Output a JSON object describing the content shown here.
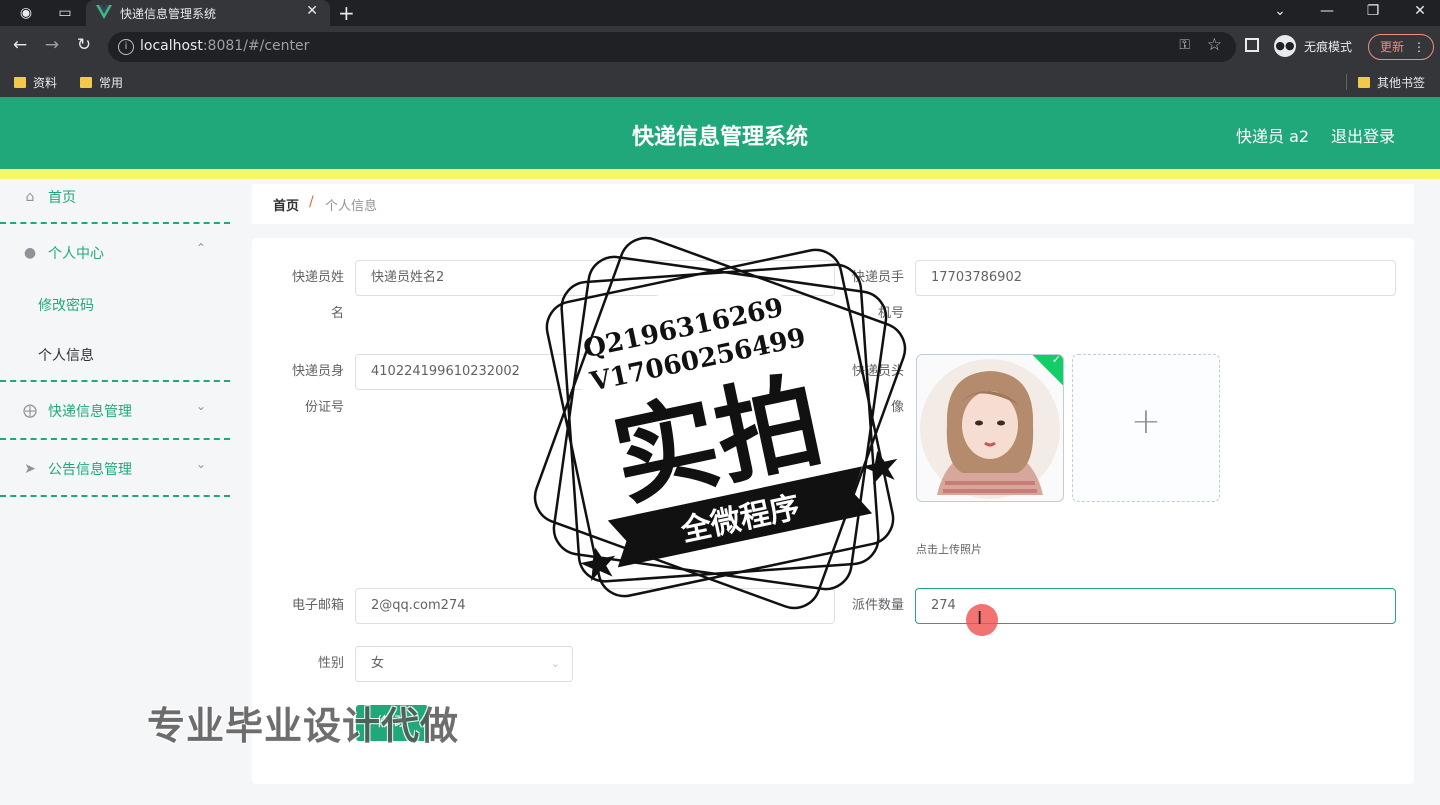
{
  "browser": {
    "tab_title": "快递信息管理系统",
    "url_host": "localhost",
    "url_rest": ":8081/#/center",
    "incognito_label": "无痕模式",
    "update_label": "更新",
    "bookmarks": [
      "资料",
      "常用"
    ],
    "other_bookmarks": "其他书签"
  },
  "header": {
    "title": "快递信息管理系统",
    "user": "快递员 a2",
    "logout": "退出登录",
    "bg_color": "#20a87b",
    "stripe_color": "#f4f766"
  },
  "sidebar": {
    "home": "首页",
    "personal_center": "个人中心",
    "change_password": "修改密码",
    "personal_info": "个人信息",
    "express_mgmt": "快递信息管理",
    "notice_mgmt": "公告信息管理"
  },
  "breadcrumb": {
    "home": "首页",
    "separator": "/",
    "current": "个人信息"
  },
  "form": {
    "name_label_1": "快递员姓",
    "name_label_2": "名",
    "name_value": "快递员姓名2",
    "phone_label_1": "快递员手",
    "phone_label_2": "机号",
    "phone_value": "17703786902",
    "id_label_1": "快递员身",
    "id_label_2": "份证号",
    "id_value": "410224199610232002",
    "avatar_label_1": "快递员头",
    "avatar_label_2": "像",
    "upload_tip": "点击上传照片",
    "email_label": "电子邮箱",
    "email_value": "2@qq.com274",
    "count_label": "派件数量",
    "count_value": "274",
    "gender_label": "性别",
    "gender_value": "女",
    "submit": "修 改"
  },
  "overlay": {
    "stamp_line1": "Q2196316269",
    "stamp_line2": "V17060256499",
    "stamp_big": "实拍",
    "stamp_ribbon": "全微程序",
    "ad_text": "专业毕业设计代做"
  }
}
